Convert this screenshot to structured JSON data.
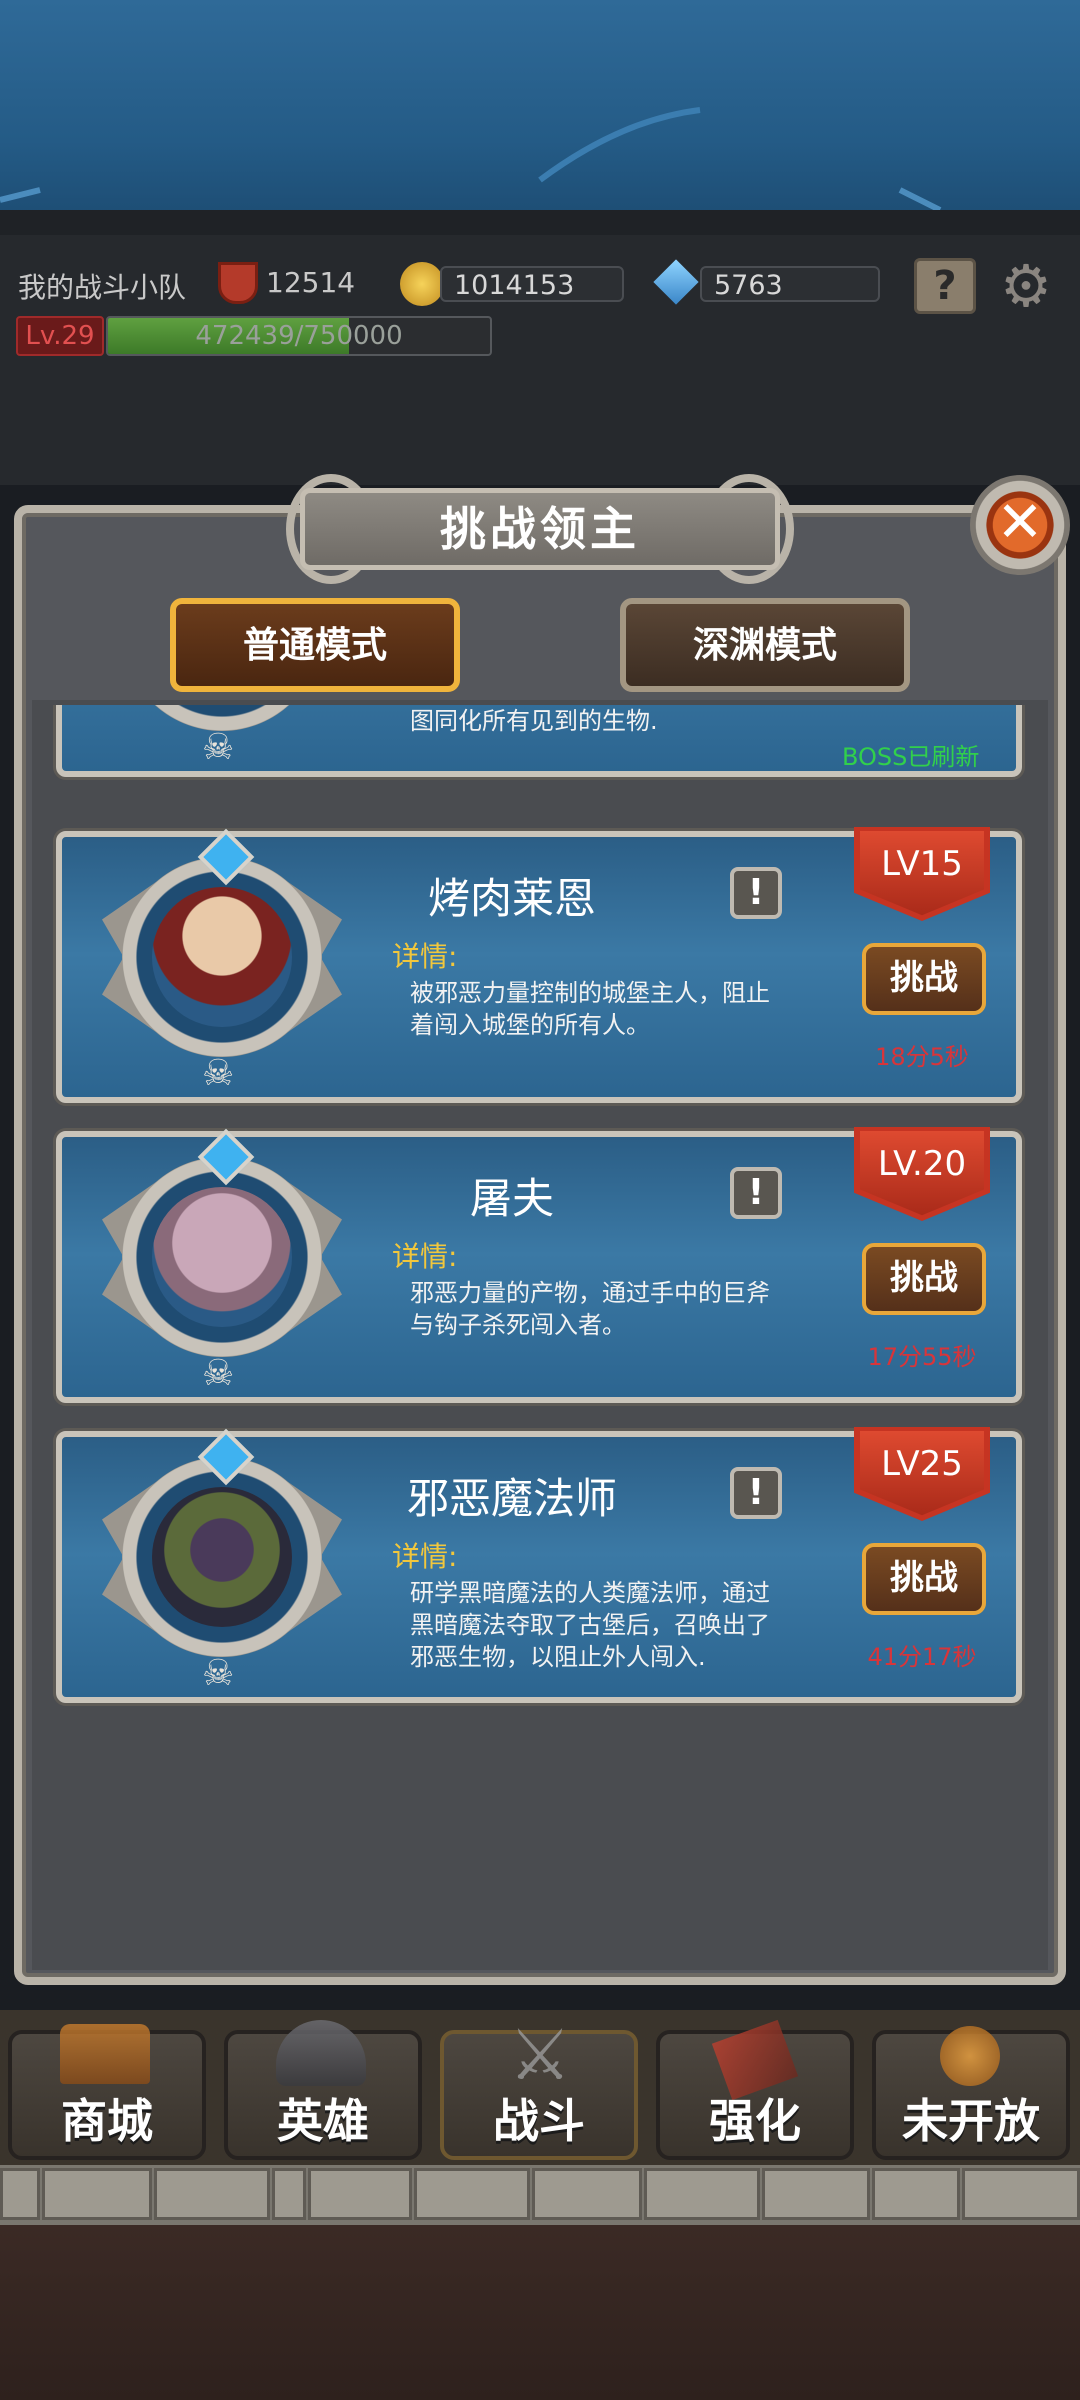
{
  "hud": {
    "team_name": "我的战斗小队",
    "power": "12514",
    "gold": "1014153",
    "gems": "5763",
    "level": "Lv.29",
    "exp": "472439/750000",
    "exp_fraction": 0.63
  },
  "dialog": {
    "title": "挑战领主",
    "close_icon": "close-icon",
    "modes": [
      "普通模式",
      "深渊模式"
    ],
    "selected_mode": "普通模式"
  },
  "partial_card": {
    "desc": "图同化所有见到的生物.",
    "status": "BOSS已刷新"
  },
  "bosses": [
    {
      "name": "烤肉莱恩",
      "level": "LV15",
      "detail_label": "详情:",
      "desc": "被邪恶力量控制的城堡主人，阻止着闯入城堡的所有人。",
      "button": "挑战",
      "timer": "18分5秒"
    },
    {
      "name": "屠夫",
      "level": "LV.20",
      "detail_label": "详情:",
      "desc": "邪恶力量的产物，通过手中的巨斧与钩子杀死闯入者。",
      "button": "挑战",
      "timer": "17分55秒"
    },
    {
      "name": "邪恶魔法师",
      "level": "LV25",
      "detail_label": "详情:",
      "desc": "研学黑暗魔法的人类魔法师，通过黑暗魔法夺取了古堡后，召唤出了邪恶生物，以阻止外人闯入.",
      "button": "挑战",
      "timer": "41分17秒"
    }
  ],
  "nav": [
    {
      "label": "商城",
      "icon": "treasure-chest-icon"
    },
    {
      "label": "英雄",
      "icon": "helmet-icon"
    },
    {
      "label": "战斗",
      "icon": "crossed-swords-icon"
    },
    {
      "label": "强化",
      "icon": "hammer-icon"
    },
    {
      "label": "未开放",
      "icon": "locked-icon"
    }
  ],
  "colors": {
    "gold_button_border": "#f0b43c",
    "timer_red": "#d8353a",
    "status_green": "#31d04b"
  }
}
